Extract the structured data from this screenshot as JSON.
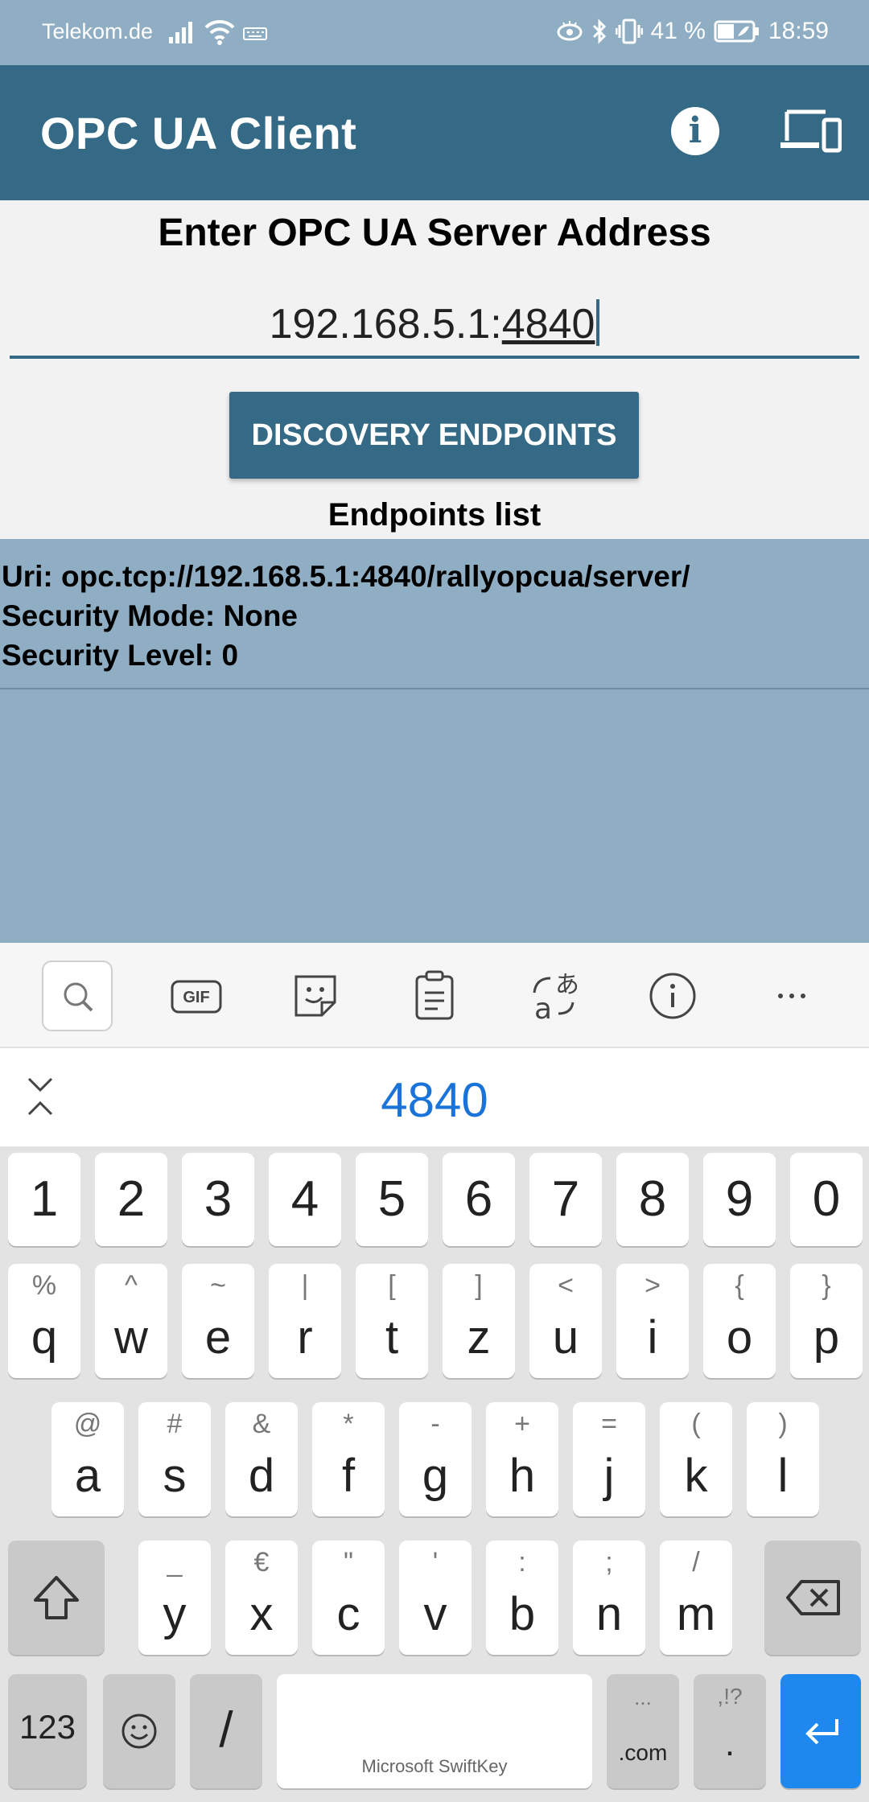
{
  "status_bar": {
    "carrier": "Telekom.de",
    "battery": "41 %",
    "time": "18:59"
  },
  "app_bar": {
    "title": "OPC UA Client",
    "info_icon": "info-icon",
    "devices_icon": "devices-icon"
  },
  "main": {
    "heading": "Enter OPC UA Server Address",
    "address": {
      "prefix": "192.168.5.1:",
      "composing": "4840"
    },
    "discovery_button": "DISCOVERY ENDPOINTS",
    "endpoints_label": "Endpoints list",
    "endpoints": [
      {
        "uri": "Uri: opc.tcp://192.168.5.1:4840/rallyopcua/server/",
        "security_mode": "Security Mode: None",
        "security_level": "Security Level: 0"
      }
    ]
  },
  "colors": {
    "primary": "#346a86",
    "list_background": "#8fadc3",
    "keyboard_accent": "#1e88ef"
  },
  "keyboard": {
    "toolbar_icons": [
      "search-icon",
      "gif-icon",
      "sticker-icon",
      "clipboard-icon",
      "translate-icon",
      "info-icon",
      "more-icon"
    ],
    "prediction": "4840",
    "number_row": [
      "1",
      "2",
      "3",
      "4",
      "5",
      "6",
      "7",
      "8",
      "9",
      "0"
    ],
    "row1": [
      {
        "k": "q",
        "a": "%"
      },
      {
        "k": "w",
        "a": "^"
      },
      {
        "k": "e",
        "a": "~"
      },
      {
        "k": "r",
        "a": "|"
      },
      {
        "k": "t",
        "a": "["
      },
      {
        "k": "z",
        "a": "]"
      },
      {
        "k": "u",
        "a": "<"
      },
      {
        "k": "i",
        "a": ">"
      },
      {
        "k": "o",
        "a": "{"
      },
      {
        "k": "p",
        "a": "}"
      }
    ],
    "row2": [
      {
        "k": "a",
        "a": "@"
      },
      {
        "k": "s",
        "a": "#"
      },
      {
        "k": "d",
        "a": "&"
      },
      {
        "k": "f",
        "a": "*"
      },
      {
        "k": "g",
        "a": "-"
      },
      {
        "k": "h",
        "a": "+"
      },
      {
        "k": "j",
        "a": "="
      },
      {
        "k": "k",
        "a": "("
      },
      {
        "k": "l",
        "a": ")"
      }
    ],
    "row3": [
      {
        "k": "y",
        "a": "_"
      },
      {
        "k": "x",
        "a": "€"
      },
      {
        "k": "c",
        "a": "\""
      },
      {
        "k": "v",
        "a": "'"
      },
      {
        "k": "b",
        "a": ":"
      },
      {
        "k": "n",
        "a": ";"
      },
      {
        "k": "m",
        "a": "/"
      }
    ],
    "bottom": {
      "numbers": "123",
      "emoji_icon": "emoji-icon",
      "slash": "/",
      "space_brand": "Microsoft SwiftKey",
      "dotcom_alt": "...",
      "dotcom": ".com",
      "period_alt": ",!?",
      "period": ".",
      "enter_icon": "enter-icon",
      "shift_icon": "shift-icon",
      "backspace_icon": "backspace-icon"
    }
  }
}
